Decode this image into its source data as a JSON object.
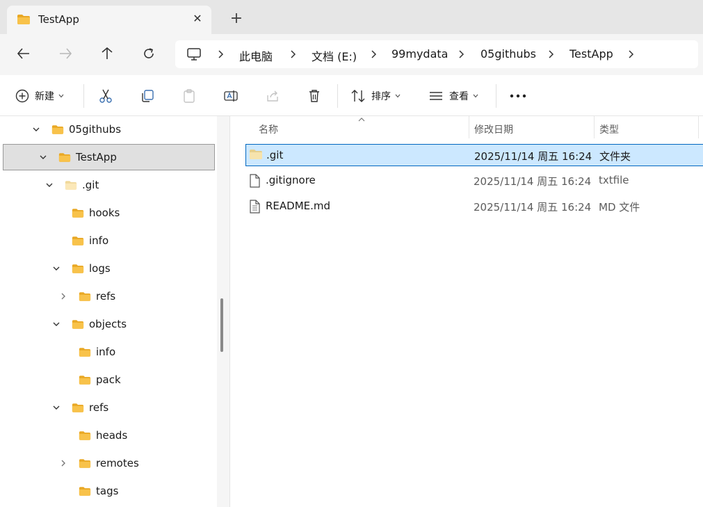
{
  "tab": {
    "title": "TestApp"
  },
  "breadcrumb": [
    "此电脑",
    "文档 (E:)",
    "99mydata",
    "05githubs",
    "TestApp"
  ],
  "toolbar": {
    "new_label": "新建",
    "sort_label": "排序",
    "view_label": "查看"
  },
  "nav_tree": [
    {
      "label": "05githubs",
      "expanded": true
    },
    {
      "label": "TestApp",
      "expanded": true,
      "selected": true
    },
    {
      "label": ".git",
      "expanded": true
    },
    {
      "label": "hooks"
    },
    {
      "label": "info"
    },
    {
      "label": "logs",
      "expanded": true
    },
    {
      "label": "refs",
      "collapsed": true
    },
    {
      "label": "objects",
      "expanded": true
    },
    {
      "label": "info"
    },
    {
      "label": "pack"
    },
    {
      "label": "refs",
      "expanded": true
    },
    {
      "label": "heads"
    },
    {
      "label": "remotes",
      "collapsed": true
    },
    {
      "label": "tags"
    }
  ],
  "columns": {
    "name": "名称",
    "date": "修改日期",
    "type": "类型"
  },
  "files": [
    {
      "name": ".git",
      "date": "2025/11/14 周五 16:24",
      "type": "文件夹",
      "icon": "folder-icon",
      "selected": true
    },
    {
      "name": ".gitignore",
      "date": "2025/11/14 周五 16:24",
      "type": "txtfile",
      "icon": "file-icon"
    },
    {
      "name": "README.md",
      "date": "2025/11/14 周五 16:24",
      "type": "MD 文件",
      "icon": "text-file-icon"
    }
  ],
  "colors": {
    "selection": "#cce8ff",
    "selection_border": "#0067c0",
    "folder_yellow": "#f8c24a"
  }
}
